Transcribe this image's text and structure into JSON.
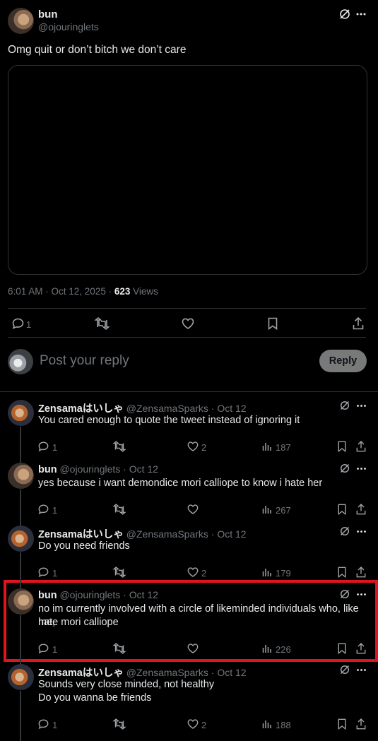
{
  "main_post": {
    "display_name": "bun",
    "handle": "@ojouringlets",
    "text": "Omg quit or don’t bitch we don’t care",
    "meta_time": "6:01 AM · Oct 12, 2025 · ",
    "views_count": "623",
    "views_label": " Views",
    "reply_count": "1"
  },
  "composer": {
    "placeholder": "Post your reply",
    "reply_button": "Reply"
  },
  "replies": [
    {
      "name": "Zensamaはいしゃ",
      "meta": "@ZensamaSparks · Oct 12",
      "lines": [
        "You cared enough to quote the tweet instead of ignoring it"
      ],
      "replies": "1",
      "likes": "2",
      "views": "187"
    },
    {
      "name": "bun",
      "meta": "@ojouringlets · Oct 12",
      "lines": [
        "yes because i want demondice mori calliope to know i hate her"
      ],
      "replies": "1",
      "likes": "",
      "views": "267"
    },
    {
      "name": "Zensamaはいしゃ",
      "meta": "@ZensamaSparks · Oct 12",
      "lines": [
        "Do you need friends"
      ],
      "replies": "1",
      "likes": "2",
      "views": "179"
    },
    {
      "name": "bun",
      "meta": "@ojouringlets · Oct 12",
      "lines": [
        "no im currently involved with a circle of likeminded individuals who, like me,",
        "hate mori calliope"
      ],
      "replies": "1",
      "likes": "",
      "views": "226"
    },
    {
      "name": "Zensamaはいしゃ",
      "meta": "@ZensamaSparks · Oct 12",
      "lines": [
        "Sounds very close minded, not healthy",
        "Do you wanna be friends"
      ],
      "replies": "1",
      "likes": "2",
      "views": "188"
    }
  ],
  "highlight_color": "#e0141e"
}
